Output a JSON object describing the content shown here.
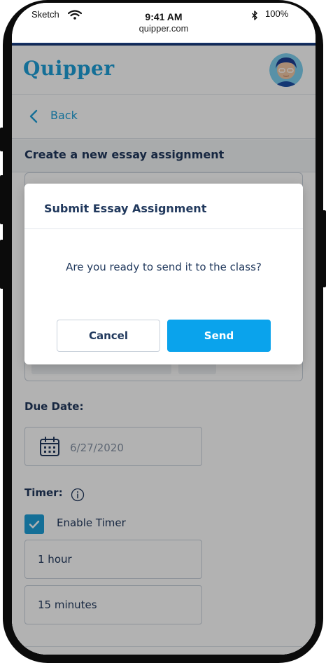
{
  "status_bar": {
    "carrier": "Sketch",
    "time": "9:41 AM",
    "url": "quipper.com",
    "battery": "100%"
  },
  "header": {
    "logo": "Quipper",
    "avatar_icon": "user-avatar-icon"
  },
  "nav": {
    "back_label": "Back"
  },
  "page": {
    "title": "Create a new essay assignment",
    "due_date_label": "Due Date:",
    "due_date_value": "6/27/2020",
    "timer_label": "Timer:",
    "enable_timer_label": "Enable Timer",
    "enable_timer_checked": true,
    "hours_value": "1 hour",
    "minutes_value": "15 minutes"
  },
  "modal": {
    "title": "Submit Essay Assignment",
    "message": "Are you ready to send it to the class?",
    "cancel_label": "Cancel",
    "send_label": "Send"
  },
  "colors": {
    "brand": "#1ea0d8",
    "send_button": "#0aa3ec",
    "text_primary": "#21395d",
    "top_rule": "#1a3c7a"
  }
}
